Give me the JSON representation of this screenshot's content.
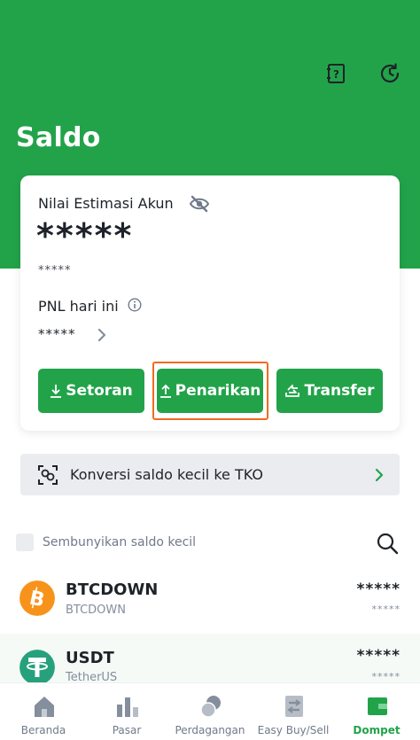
{
  "header": {
    "title": "Saldo",
    "icons": [
      "help-document-icon",
      "history-clock-icon"
    ]
  },
  "account_card": {
    "estimate_label": "Nilai Estimasi Akun",
    "estimate_value": "*****",
    "estimate_secondary": "*****",
    "pnl_label": "PNL hari ini",
    "pnl_value": "*****"
  },
  "actions": {
    "deposit_label": "Setoran",
    "withdraw_label": "Penarikan",
    "transfer_label": "Transfer"
  },
  "convert_bar": {
    "label": "Konversi saldo kecil ke TKO"
  },
  "filter": {
    "hide_small_label": "Sembunyikan saldo kecil",
    "hide_small_checked": false
  },
  "assets": [
    {
      "symbol": "BTCDOWN",
      "name": "BTCDOWN",
      "value": "*****",
      "value_sub": "*****",
      "icon": "bitcoin-icon",
      "color": "#f7931a"
    },
    {
      "symbol": "USDT",
      "name": "TetherUS",
      "value": "*****",
      "value_sub": "*****",
      "icon": "tether-icon",
      "color": "#26a17b"
    }
  ],
  "bottom_nav": [
    {
      "label": "Beranda",
      "icon": "home-icon",
      "active": false
    },
    {
      "label": "Pasar",
      "icon": "market-bars-icon",
      "active": false
    },
    {
      "label": "Perdagangan",
      "icon": "trade-coins-icon",
      "active": false
    },
    {
      "label": "Easy Buy/Sell",
      "icon": "exchange-icon",
      "active": false
    },
    {
      "label": "Dompet",
      "icon": "wallet-icon",
      "active": true
    }
  ],
  "colors": {
    "brand_green": "#22a34a",
    "highlight_orange": "#f06b1f"
  }
}
